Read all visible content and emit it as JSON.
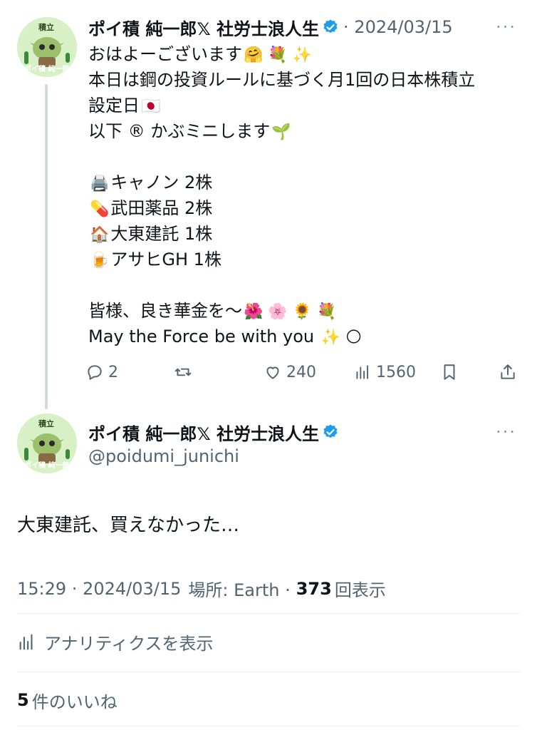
{
  "tweet1": {
    "display_name": "ポイ積 純一郎𝕏 社労士浪人生",
    "date": "· 2024/03/15",
    "more_icon": "···",
    "avatar": {
      "label_top": "積立",
      "label_bottom": "ポイ積 純一郎"
    },
    "lines": [
      "おはよーございます",
      "本日は鋼の投資ルールに基づく月1回の日本株積立",
      "設定日",
      "以下 ® かぶミニします",
      "",
      "キャノン 2株",
      "武田薬品 2株",
      "大東建託 1株",
      "アサヒGH 1株",
      "",
      "皆様、良き華金を〜",
      "May the Force be with you"
    ],
    "emoji": {
      "l0": "🤗 💐 ✨",
      "l2": "🇯🇵",
      "l3": "🌱",
      "l5": "🖨️",
      "l6": "💊",
      "l7": "🏠",
      "l8": "🍺",
      "l10": "🌺 🌸 🌻 💐",
      "l11": "✨ 🌕"
    },
    "actions": {
      "replies": "2",
      "likes": "240",
      "views": "1560"
    }
  },
  "tweet2": {
    "display_name": "ポイ積 純一郎𝕏 社労士浪人生",
    "handle": "@poidumi_junichi",
    "more_icon": "···",
    "avatar": {
      "label_top": "積立",
      "label_bottom": "ポイ積 純一郎"
    },
    "text": "大東建託、買えなかった…",
    "time": "15:29 · 2024/03/15",
    "location_label": "場所: Earth ·",
    "view_count": "373",
    "view_suffix": "回表示",
    "analytics_label": "アナリティクスを表示",
    "likes_count": "5",
    "likes_suffix": "件のいいね"
  },
  "colors": {
    "verified": "#1d9bf0",
    "secondary": "#536471",
    "primary_text": "#0f1419"
  }
}
